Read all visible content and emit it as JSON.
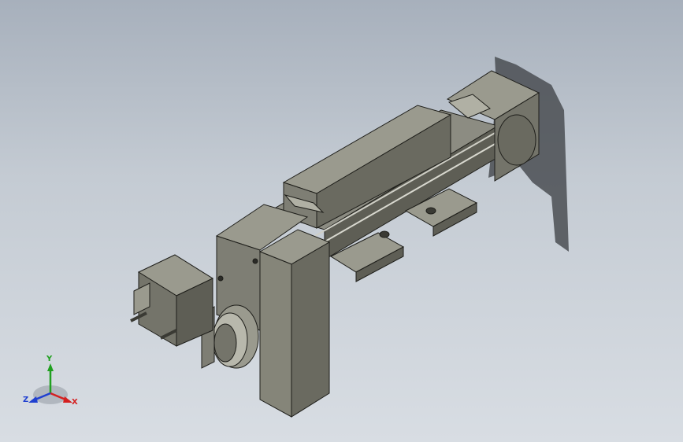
{
  "viewport": {
    "background_top": "#a7b0bc",
    "background_bottom": "#d8dde3"
  },
  "model": {
    "body_color": "#74746a",
    "body_light": "#9a9a8e",
    "body_dark": "#4a4a42",
    "edge_color": "#1e1e1a",
    "shadow_color": "#4a4d52"
  },
  "triad": {
    "x_label": "X",
    "y_label": "Y",
    "z_label": "Z",
    "x_color": "#d42020",
    "y_color": "#20a020",
    "z_color": "#2040d0"
  }
}
